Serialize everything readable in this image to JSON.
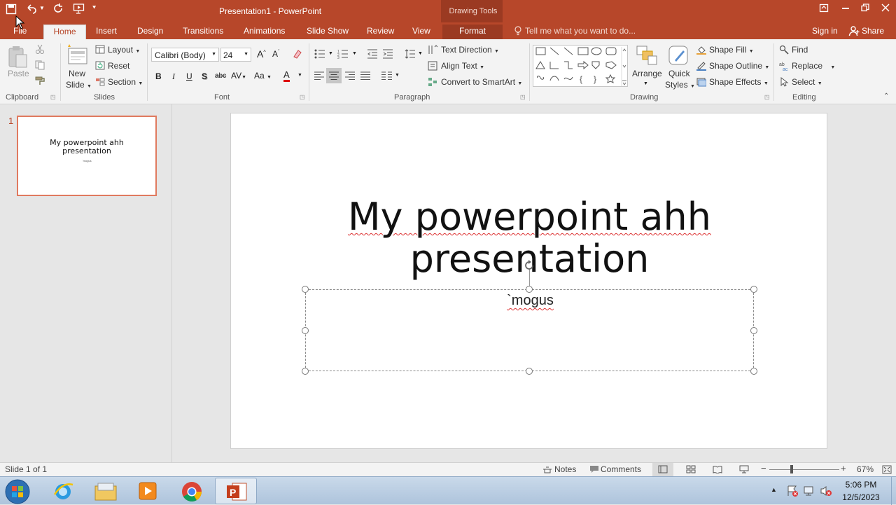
{
  "window": {
    "title": "Presentation1 - PowerPoint",
    "contextual_title": "Drawing Tools"
  },
  "tabs": [
    "File",
    "Home",
    "Insert",
    "Design",
    "Transitions",
    "Animations",
    "Slide Show",
    "Review",
    "View",
    "Format"
  ],
  "tell_me": "Tell me what you want to do...",
  "sign_in": "Sign in",
  "share": "Share",
  "ribbon": {
    "clipboard": {
      "paste": "Paste",
      "label": "Clipboard"
    },
    "slides": {
      "new_slide_1": "New",
      "new_slide_2": "Slide",
      "layout": "Layout",
      "reset": "Reset",
      "section": "Section",
      "label": "Slides"
    },
    "font": {
      "family": "Calibri (Body)",
      "size": "24",
      "bold": "B",
      "italic": "I",
      "underline": "U",
      "shadow": "S",
      "strike": "abc",
      "spacing": "AV",
      "case": "Aa",
      "color": "A",
      "label": "Font"
    },
    "paragraph": {
      "text_direction": "Text Direction",
      "align_text": "Align Text",
      "convert_smartart": "Convert to SmartArt",
      "label": "Paragraph"
    },
    "drawing": {
      "arrange": "Arrange",
      "quick_styles_1": "Quick",
      "quick_styles_2": "Styles",
      "shape_fill": "Shape Fill",
      "shape_outline": "Shape Outline",
      "shape_effects": "Shape Effects",
      "label": "Drawing"
    },
    "editing": {
      "find": "Find",
      "replace": "Replace",
      "select": "Select",
      "label": "Editing"
    }
  },
  "thumbnail": {
    "number": "1",
    "title": "My powerpoint ahh presentation",
    "subtitle": "`mogus"
  },
  "slide": {
    "title_line1": "My powerpoint ahh",
    "title_line2": "presentation",
    "subtitle": "`mogus"
  },
  "status": {
    "slide_info": "Slide 1 of 1",
    "notes": "Notes",
    "comments": "Comments",
    "zoom": "67%"
  },
  "taskbar": {
    "time": "5:06 PM",
    "date": "12/5/2023"
  },
  "colors": {
    "accent": "#b7472a",
    "accent_dark": "#9b3a22"
  }
}
